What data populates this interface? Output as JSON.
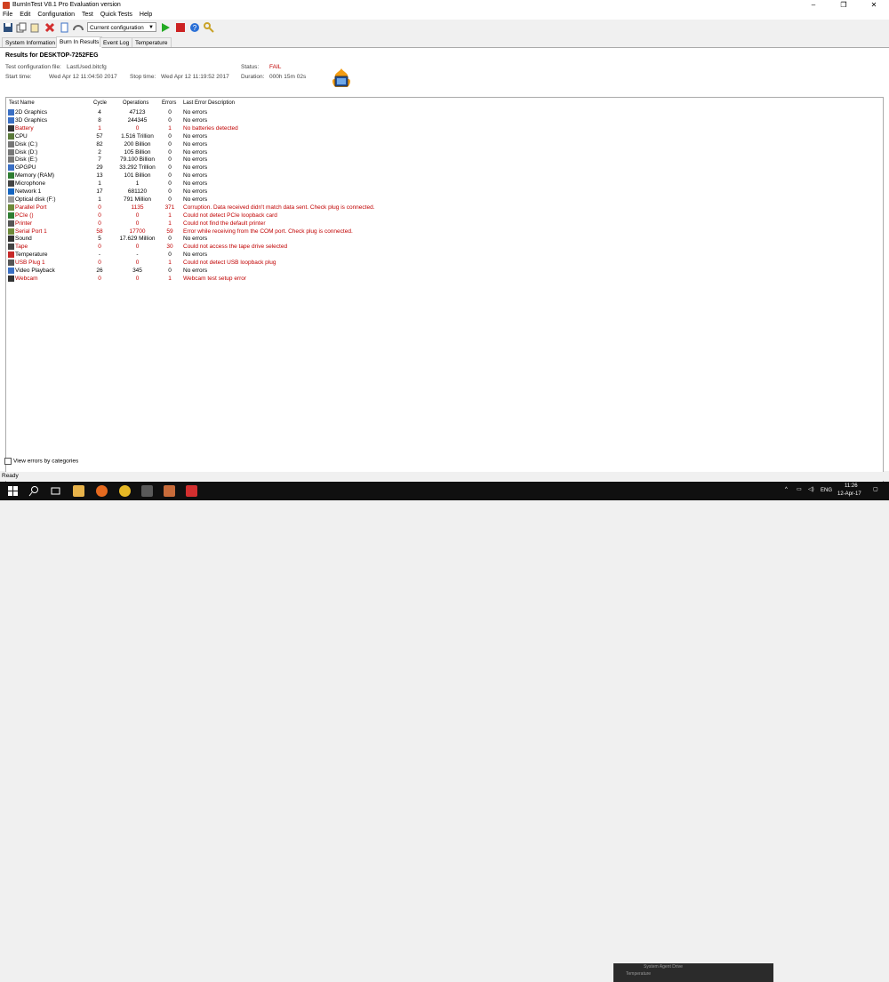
{
  "window": {
    "title": "BurnInTest V8.1 Pro Evaluation version",
    "min": "–",
    "max": "❐",
    "close": "✕"
  },
  "menu": [
    "File",
    "Edit",
    "Configuration",
    "Test",
    "Quick Tests",
    "Help"
  ],
  "toolbar": {
    "config_value": "Current configuration"
  },
  "tabs": [
    "System Information",
    "Burn In Results",
    "Event Log",
    "Temperature"
  ],
  "results": {
    "title": "Results for DESKTOP-7252FEG",
    "config_label": "Test configuration file:",
    "config_value": "LastUsed.bitcfg",
    "start_label": "Start time:",
    "start_value": "Wed Apr 12 11:04:50 2017",
    "stop_label": "Stop time:",
    "stop_value": "Wed Apr 12 11:19:52 2017",
    "status_label": "Status:",
    "status_value": "FAIL",
    "duration_label": "Duration:",
    "duration_value": "000h 15m 02s"
  },
  "columns": [
    "Test Name",
    "Cycle",
    "Operations",
    "Errors",
    "Last Error Description"
  ],
  "rows": [
    {
      "name": "2D Graphics",
      "cycle": "4",
      "ops": "47123",
      "errors": "0",
      "desc": "No errors",
      "err": false,
      "icon": "#3a6fc4"
    },
    {
      "name": "3D Graphics",
      "cycle": "8",
      "ops": "244345",
      "errors": "0",
      "desc": "No errors",
      "err": false,
      "icon": "#3a6fc4"
    },
    {
      "name": "Battery",
      "cycle": "1",
      "ops": "0",
      "errors": "1",
      "desc": "No batteries detected",
      "err": true,
      "icon": "#333333"
    },
    {
      "name": "CPU",
      "cycle": "57",
      "ops": "1.516 Trillion",
      "errors": "0",
      "desc": "No errors",
      "err": false,
      "icon": "#5a7a3a"
    },
    {
      "name": "Disk (C:)",
      "cycle": "82",
      "ops": "200 Billion",
      "errors": "0",
      "desc": "No errors",
      "err": false,
      "icon": "#777777"
    },
    {
      "name": "Disk (D:)",
      "cycle": "2",
      "ops": "105 Billion",
      "errors": "0",
      "desc": "No errors",
      "err": false,
      "icon": "#777777"
    },
    {
      "name": "Disk (E:)",
      "cycle": "7",
      "ops": "79.100 Billion",
      "errors": "0",
      "desc": "No errors",
      "err": false,
      "icon": "#777777"
    },
    {
      "name": "GPGPU",
      "cycle": "29",
      "ops": "33.292 Trillion",
      "errors": "0",
      "desc": "No errors",
      "err": false,
      "icon": "#3a6fc4"
    },
    {
      "name": "Memory (RAM)",
      "cycle": "13",
      "ops": "101 Billion",
      "errors": "0",
      "desc": "No errors",
      "err": false,
      "icon": "#2e7d32"
    },
    {
      "name": "Microphone",
      "cycle": "1",
      "ops": "1",
      "errors": "0",
      "desc": "No errors",
      "err": false,
      "icon": "#444444"
    },
    {
      "name": "Network 1",
      "cycle": "17",
      "ops": "681120",
      "errors": "0",
      "desc": "No errors",
      "err": false,
      "icon": "#1565c0"
    },
    {
      "name": "Optical disk (F:)",
      "cycle": "1",
      "ops": "791 Million",
      "errors": "0",
      "desc": "No errors",
      "err": false,
      "icon": "#999999"
    },
    {
      "name": "Parallel Port",
      "cycle": "0",
      "ops": "1135",
      "errors": "371",
      "desc": "Corruption. Data received didn't match data sent. Check plug is connected.",
      "err": true,
      "icon": "#6d8a3a"
    },
    {
      "name": "PCIe ()",
      "cycle": "0",
      "ops": "0",
      "errors": "1",
      "desc": "Could not detect PCIe loopback card",
      "err": true,
      "icon": "#2e7d32"
    },
    {
      "name": "Printer",
      "cycle": "0",
      "ops": "0",
      "errors": "1",
      "desc": "Could not find the default printer",
      "err": true,
      "icon": "#555555"
    },
    {
      "name": "Serial Port 1",
      "cycle": "58",
      "ops": "17700",
      "errors": "59",
      "desc": "Error while receiving from the COM port. Check plug is connected.",
      "err": true,
      "icon": "#6d8a3a"
    },
    {
      "name": "Sound",
      "cycle": "5",
      "ops": "17.629 Million",
      "errors": "0",
      "desc": "No errors",
      "err": false,
      "icon": "#333333"
    },
    {
      "name": "Tape",
      "cycle": "0",
      "ops": "0",
      "errors": "30",
      "desc": "Could not access the tape drive selected",
      "err": true,
      "icon": "#444444"
    },
    {
      "name": "Temperature",
      "cycle": "-",
      "ops": "-",
      "errors": "0",
      "desc": "No errors",
      "err": false,
      "icon": "#c62828"
    },
    {
      "name": "USB Plug 1",
      "cycle": "0",
      "ops": "0",
      "errors": "1",
      "desc": "Could not detect USB loopback plug",
      "err": true,
      "icon": "#555555"
    },
    {
      "name": "Video Playback",
      "cycle": "26",
      "ops": "345",
      "errors": "0",
      "desc": "No errors",
      "err": false,
      "icon": "#3a6fc4"
    },
    {
      "name": "Webcam",
      "cycle": "0",
      "ops": "0",
      "errors": "1",
      "desc": "Webcam test setup error",
      "err": true,
      "icon": "#333333"
    }
  ],
  "checkbox": {
    "label": "View errors by categories"
  },
  "status": {
    "text": "Ready"
  },
  "taskbar": {
    "lang": "ENG",
    "time": "11:26",
    "date": "12-Apr-17",
    "bg_item1": "System Agent Drive",
    "bg_item2": "Temperature"
  },
  "colors": {
    "error_text": "#c00000",
    "accent_green": "#22aa22",
    "accent_red": "#cc2222"
  }
}
